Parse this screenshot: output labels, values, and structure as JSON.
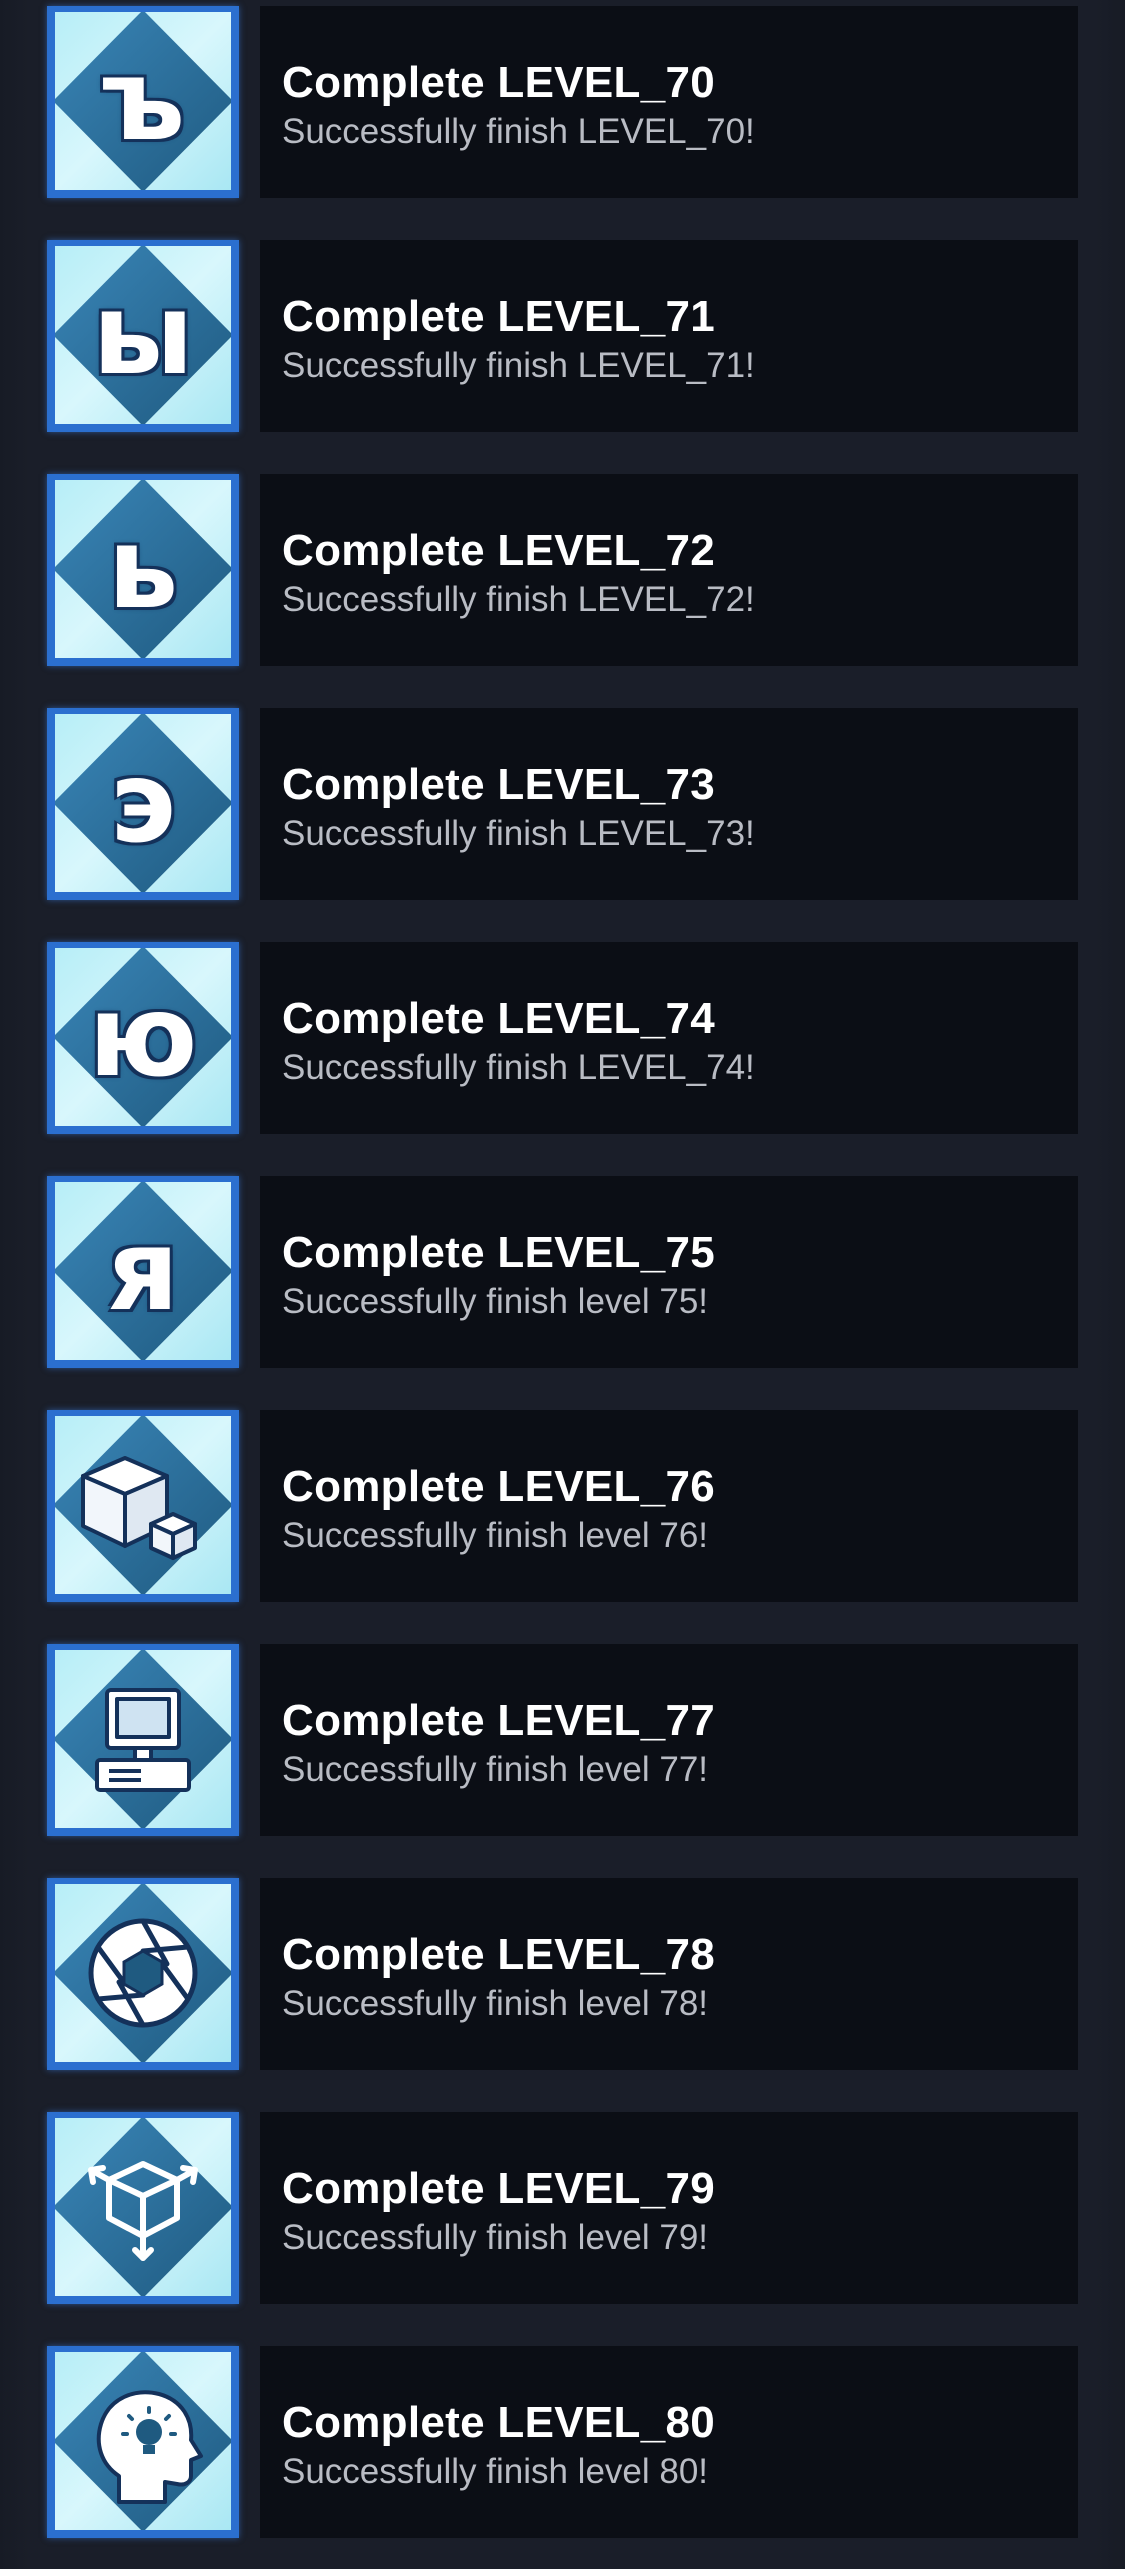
{
  "achievements": [
    {
      "title": "Complete LEVEL_70",
      "description": "Successfully finish LEVEL_70!",
      "icon": "cyrillic-hard-sign-icon",
      "glyph": "ъ"
    },
    {
      "title": "Complete LEVEL_71",
      "description": "Successfully finish LEVEL_71!",
      "icon": "cyrillic-yeru-icon",
      "glyph": "ы"
    },
    {
      "title": "Complete LEVEL_72",
      "description": "Successfully finish LEVEL_72!",
      "icon": "cyrillic-soft-sign-icon",
      "glyph": "ь"
    },
    {
      "title": "Complete LEVEL_73",
      "description": "Successfully finish LEVEL_73!",
      "icon": "cyrillic-e-icon",
      "glyph": "э"
    },
    {
      "title": "Complete LEVEL_74",
      "description": "Successfully finish LEVEL_74!",
      "icon": "cyrillic-yu-icon",
      "glyph": "ю"
    },
    {
      "title": "Complete LEVEL_75",
      "description": "Successfully finish level 75!",
      "icon": "cyrillic-ya-icon",
      "glyph": "я"
    },
    {
      "title": "Complete LEVEL_76",
      "description": "Successfully finish level 76!",
      "icon": "cubes-icon",
      "glyph": ""
    },
    {
      "title": "Complete LEVEL_77",
      "description": "Successfully finish level 77!",
      "icon": "desktop-computer-icon",
      "glyph": ""
    },
    {
      "title": "Complete LEVEL_78",
      "description": "Successfully finish level 78!",
      "icon": "camera-aperture-icon",
      "glyph": ""
    },
    {
      "title": "Complete LEVEL_79",
      "description": "Successfully finish level 79!",
      "icon": "cube-arrows-icon",
      "glyph": ""
    },
    {
      "title": "Complete LEVEL_80",
      "description": "Successfully finish level 80!",
      "icon": "head-lightbulb-icon",
      "glyph": ""
    }
  ],
  "colors": {
    "background": "#1a1e29",
    "card": "#0b0e15",
    "frame": "#2b6fcf",
    "icon_light": "#c6f2f9",
    "icon_diamond": "#2c6b96",
    "title": "#ffffff",
    "description": "#b9bcc4"
  }
}
